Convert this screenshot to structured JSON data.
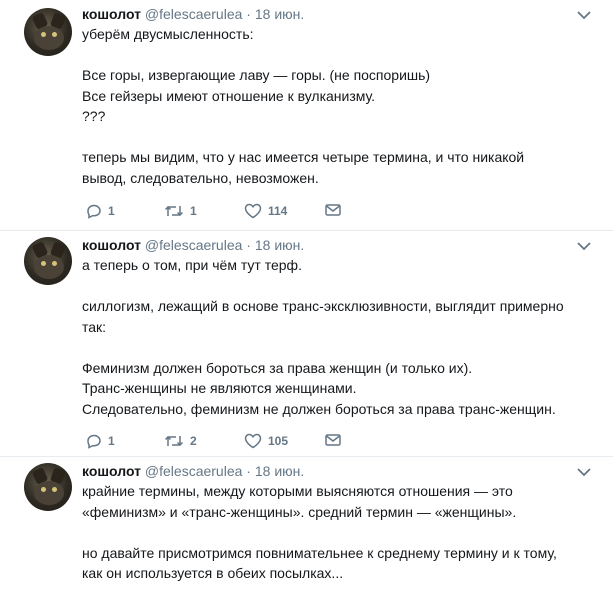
{
  "tweets": [
    {
      "name": "кошолот",
      "handle": "@felescaerulea",
      "separator": "·",
      "date": "18 июн.",
      "text": "уберём двусмысленность:\n\nВсе горы, извергающие лаву — горы. (не поспоришь)\nВсе гейзеры имеют отношение к вулканизму.\n???\n\nтеперь мы видим, что у нас имеется четыре термина, и что никакой\nвывод, следовательно, невозможен.",
      "replies": "1",
      "retweets": "1",
      "likes": "114"
    },
    {
      "name": "кошолот",
      "handle": "@felescaerulea",
      "separator": "·",
      "date": "18 июн.",
      "text": "а теперь о том, при чём тут терф.\n\nсиллогизм, лежащий в основе транс-эксклюзивности, выглядит примерно\nтак:\n\nФеминизм должен бороться за права женщин (и только их).\nТранс-женщины не являются женщинами.\nСледовательно, феминизм не должен бороться за права транс-женщин.",
      "replies": "1",
      "retweets": "2",
      "likes": "105"
    },
    {
      "name": "кошолот",
      "handle": "@felescaerulea",
      "separator": "·",
      "date": "18 июн.",
      "text": "крайние термины, между которыми выясняются отношения — это\n«феминизм» и «транс-женщины». средний термин — «женщины».\n\nно давайте присмотримся повнимательнее к среднему термину и к тому,\nкак он используется в обеих посылках...",
      "replies": "",
      "retweets": "",
      "likes": ""
    }
  ],
  "icons": {
    "reply": "reply-icon",
    "retweet": "retweet-icon",
    "like": "heart-icon",
    "dm": "envelope-icon",
    "menu": "chevron-down-icon"
  },
  "colors": {
    "text": "#14171a",
    "muted": "#657786",
    "border": "#e6ecf0"
  }
}
